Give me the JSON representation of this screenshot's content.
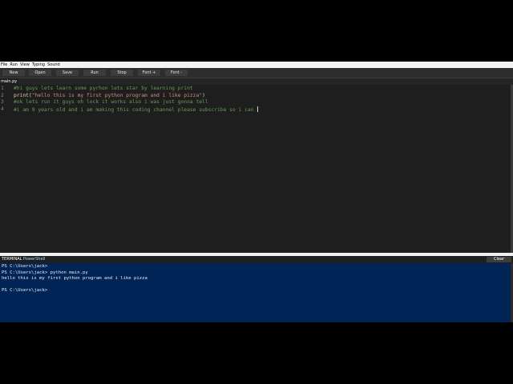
{
  "menu": [
    "File",
    "Run",
    "View",
    "Typing",
    "Sound"
  ],
  "toolbar": [
    "New",
    "Open",
    "Save",
    "Run",
    "Stop",
    "Font +",
    "Font -"
  ],
  "tab": {
    "label": "main.py *"
  },
  "editor": {
    "lines": [
      {
        "num": "1",
        "text": "#hi guys lets learn some pyrhon lets star by learning print"
      },
      {
        "num": "2",
        "text_kw": "print(",
        "text_str": "\"hello this is my first python program and i like pizza\"",
        "text_end": ")"
      },
      {
        "num": "3",
        "text": "#ok lets run it guys oh lock it works also i was just gonna tell"
      },
      {
        "num": "4",
        "text": "#i am 9 years old and i am making this coding channel please subscribe so i can "
      }
    ]
  },
  "terminal": {
    "tab_label": "TERMINAL",
    "shell_label": "PowerShell",
    "clear_label": "Clear",
    "lines": [
      "PS C:\\Users\\jack>",
      "PS C:\\Users\\jack> python main.py",
      "hello this is my first python program and i like pizza",
      "",
      "PS C:\\Users\\jack>"
    ]
  },
  "colors": {
    "editor_bg": "#1e1e1e",
    "comment": "#6a9955",
    "terminal_bg": "#012456"
  }
}
